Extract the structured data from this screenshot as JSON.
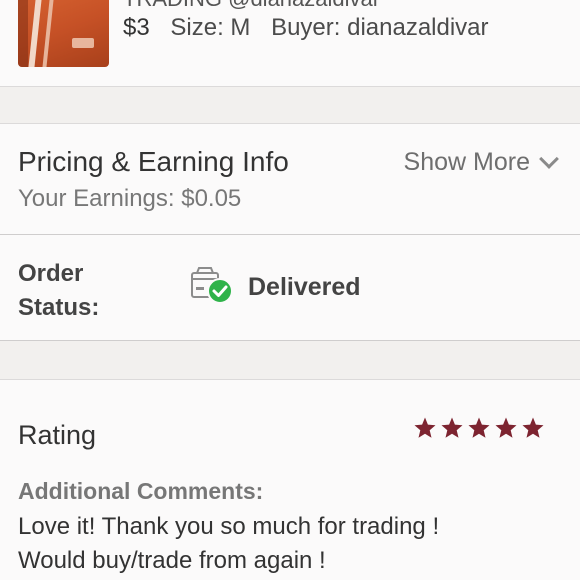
{
  "item": {
    "title": "TRADING @dianazaldivar",
    "price": "$3",
    "size": "Size: M",
    "buyer": "Buyer: dianazaldivar"
  },
  "pricing": {
    "heading": "Pricing & Earning Info",
    "earnings": "Your Earnings: $0.05",
    "show_more": "Show More"
  },
  "order_status": {
    "label_line1": "Order",
    "label_line2": "Status:",
    "value": "Delivered"
  },
  "rating": {
    "heading": "Rating",
    "stars": 5,
    "star_color": "#7d2430",
    "comments_label": "Additional Comments:",
    "comment_line1": "Love it! Thank you so much for trading !",
    "comment_line2": "Would buy/trade from again !"
  },
  "colors": {
    "delivered_check": "#2fb34a",
    "background": "#f2f0ee",
    "card": "#fbfafa"
  },
  "icons": {
    "status": "delivered-box-icon",
    "expand": "chevron-down-icon",
    "star": "star-icon"
  }
}
